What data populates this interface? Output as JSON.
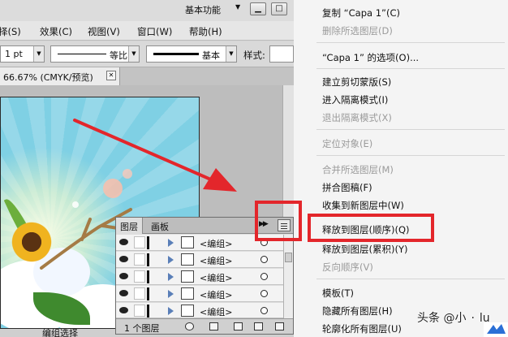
{
  "workspace": {
    "label": "基本功能"
  },
  "menubar": {
    "items": [
      "择(S)",
      "效果(C)",
      "视图(V)",
      "窗口(W)",
      "帮助(H)"
    ]
  },
  "controlbar": {
    "stroke_weight": "1 pt",
    "profile_label": "等比",
    "brush_label": "基本",
    "style_label": "样式:"
  },
  "document": {
    "tab_title": "66.67% (CMYK/预览)",
    "status_text": "编组选择"
  },
  "layers_panel": {
    "tabs": [
      "图层",
      "画板"
    ],
    "rows": [
      "<编组>",
      "<编组>",
      "<编组>",
      "<编组>",
      "<编组>"
    ],
    "footer_count": "1 个图层"
  },
  "context_menu": {
    "items": [
      {
        "label": "复制 “Capa 1”(C)",
        "enabled": true
      },
      {
        "label": "删除所选图层(D)",
        "enabled": false
      },
      {
        "label": "“Capa 1” 的选项(O)...",
        "enabled": true
      },
      {
        "label": "建立剪切蒙版(S)",
        "enabled": true
      },
      {
        "label": "进入隔离模式(I)",
        "enabled": true
      },
      {
        "label": "退出隔离模式(X)",
        "enabled": false
      },
      {
        "label": "定位对象(E)",
        "enabled": false
      },
      {
        "label": "合并所选图层(M)",
        "enabled": false
      },
      {
        "label": "拼合图稿(F)",
        "enabled": true
      },
      {
        "label": "收集到新图层中(W)",
        "enabled": true
      },
      {
        "label": "释放到图层(顺序)(Q)",
        "enabled": true
      },
      {
        "label": "释放到图层(累积)(Y)",
        "enabled": true
      },
      {
        "label": "反向顺序(V)",
        "enabled": false
      },
      {
        "label": "模板(T)",
        "enabled": true
      },
      {
        "label": "隐藏所有图层(H)",
        "enabled": true
      },
      {
        "label": "轮廓化所有图层(U)",
        "enabled": true
      }
    ]
  },
  "watermark": {
    "text_main": "头条 @小",
    "text_dot": "·",
    "text_tail": "lu"
  },
  "colors": {
    "highlight": "#e3262b",
    "arrow": "#e3262b",
    "sky": "#7fd0e4"
  },
  "icons": [
    "eye-icon",
    "expand-triangle-icon",
    "target-circle-icon",
    "panel-menu-icon",
    "close-icon"
  ]
}
